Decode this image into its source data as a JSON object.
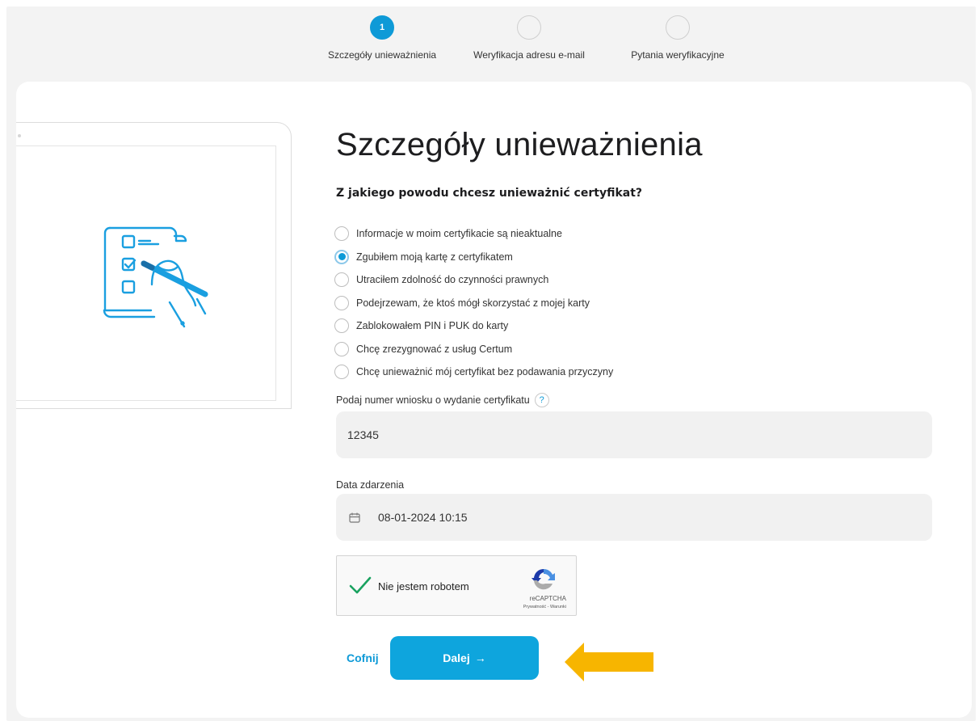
{
  "stepper": {
    "steps": [
      {
        "number": "1",
        "label": "Szczegóły unieważnienia",
        "active": true
      },
      {
        "number": "",
        "label": "Weryfikacja adresu e-mail",
        "active": false
      },
      {
        "number": "",
        "label": "Pytania weryfikacyjne",
        "active": false
      }
    ]
  },
  "form": {
    "title": "Szczegóły unieważnienia",
    "question": "Z jakiego powodu chcesz unieważnić certyfikat?",
    "reasons": [
      {
        "label": "Informacje w moim certyfikacie są nieaktualne",
        "selected": false
      },
      {
        "label": "Zgubiłem moją kartę z certyfikatem",
        "selected": true
      },
      {
        "label": "Utraciłem zdolność do czynności prawnych",
        "selected": false
      },
      {
        "label": "Podejrzewam, że ktoś mógł skorzystać z mojej karty",
        "selected": false
      },
      {
        "label": "Zablokowałem PIN i PUK do karty",
        "selected": false
      },
      {
        "label": "Chcę zrezygnować z usług Certum",
        "selected": false
      },
      {
        "label": "Chcę unieważnić mój certyfikat bez podawania przyczyny",
        "selected": false
      }
    ],
    "application_number": {
      "label": "Podaj numer wniosku o wydanie certyfikatu",
      "help_icon": "question-icon",
      "help_glyph": "?",
      "value": "12345"
    },
    "event_date": {
      "label": "Data zdarzenia",
      "icon": "calendar-icon",
      "value": "08-01-2024 10:15"
    }
  },
  "captcha": {
    "checkbox_label": "Nie jestem robotem",
    "checked": true,
    "brand": "reCAPTCHA",
    "links": "Prywatność - Warunki"
  },
  "actions": {
    "back_label": "Cofnij",
    "next_label": "Dalej",
    "next_arrow": "→"
  },
  "colors": {
    "accent": "#0ea5dd",
    "hint_arrow": "#f7b500",
    "captcha_check": "#1aa260"
  }
}
